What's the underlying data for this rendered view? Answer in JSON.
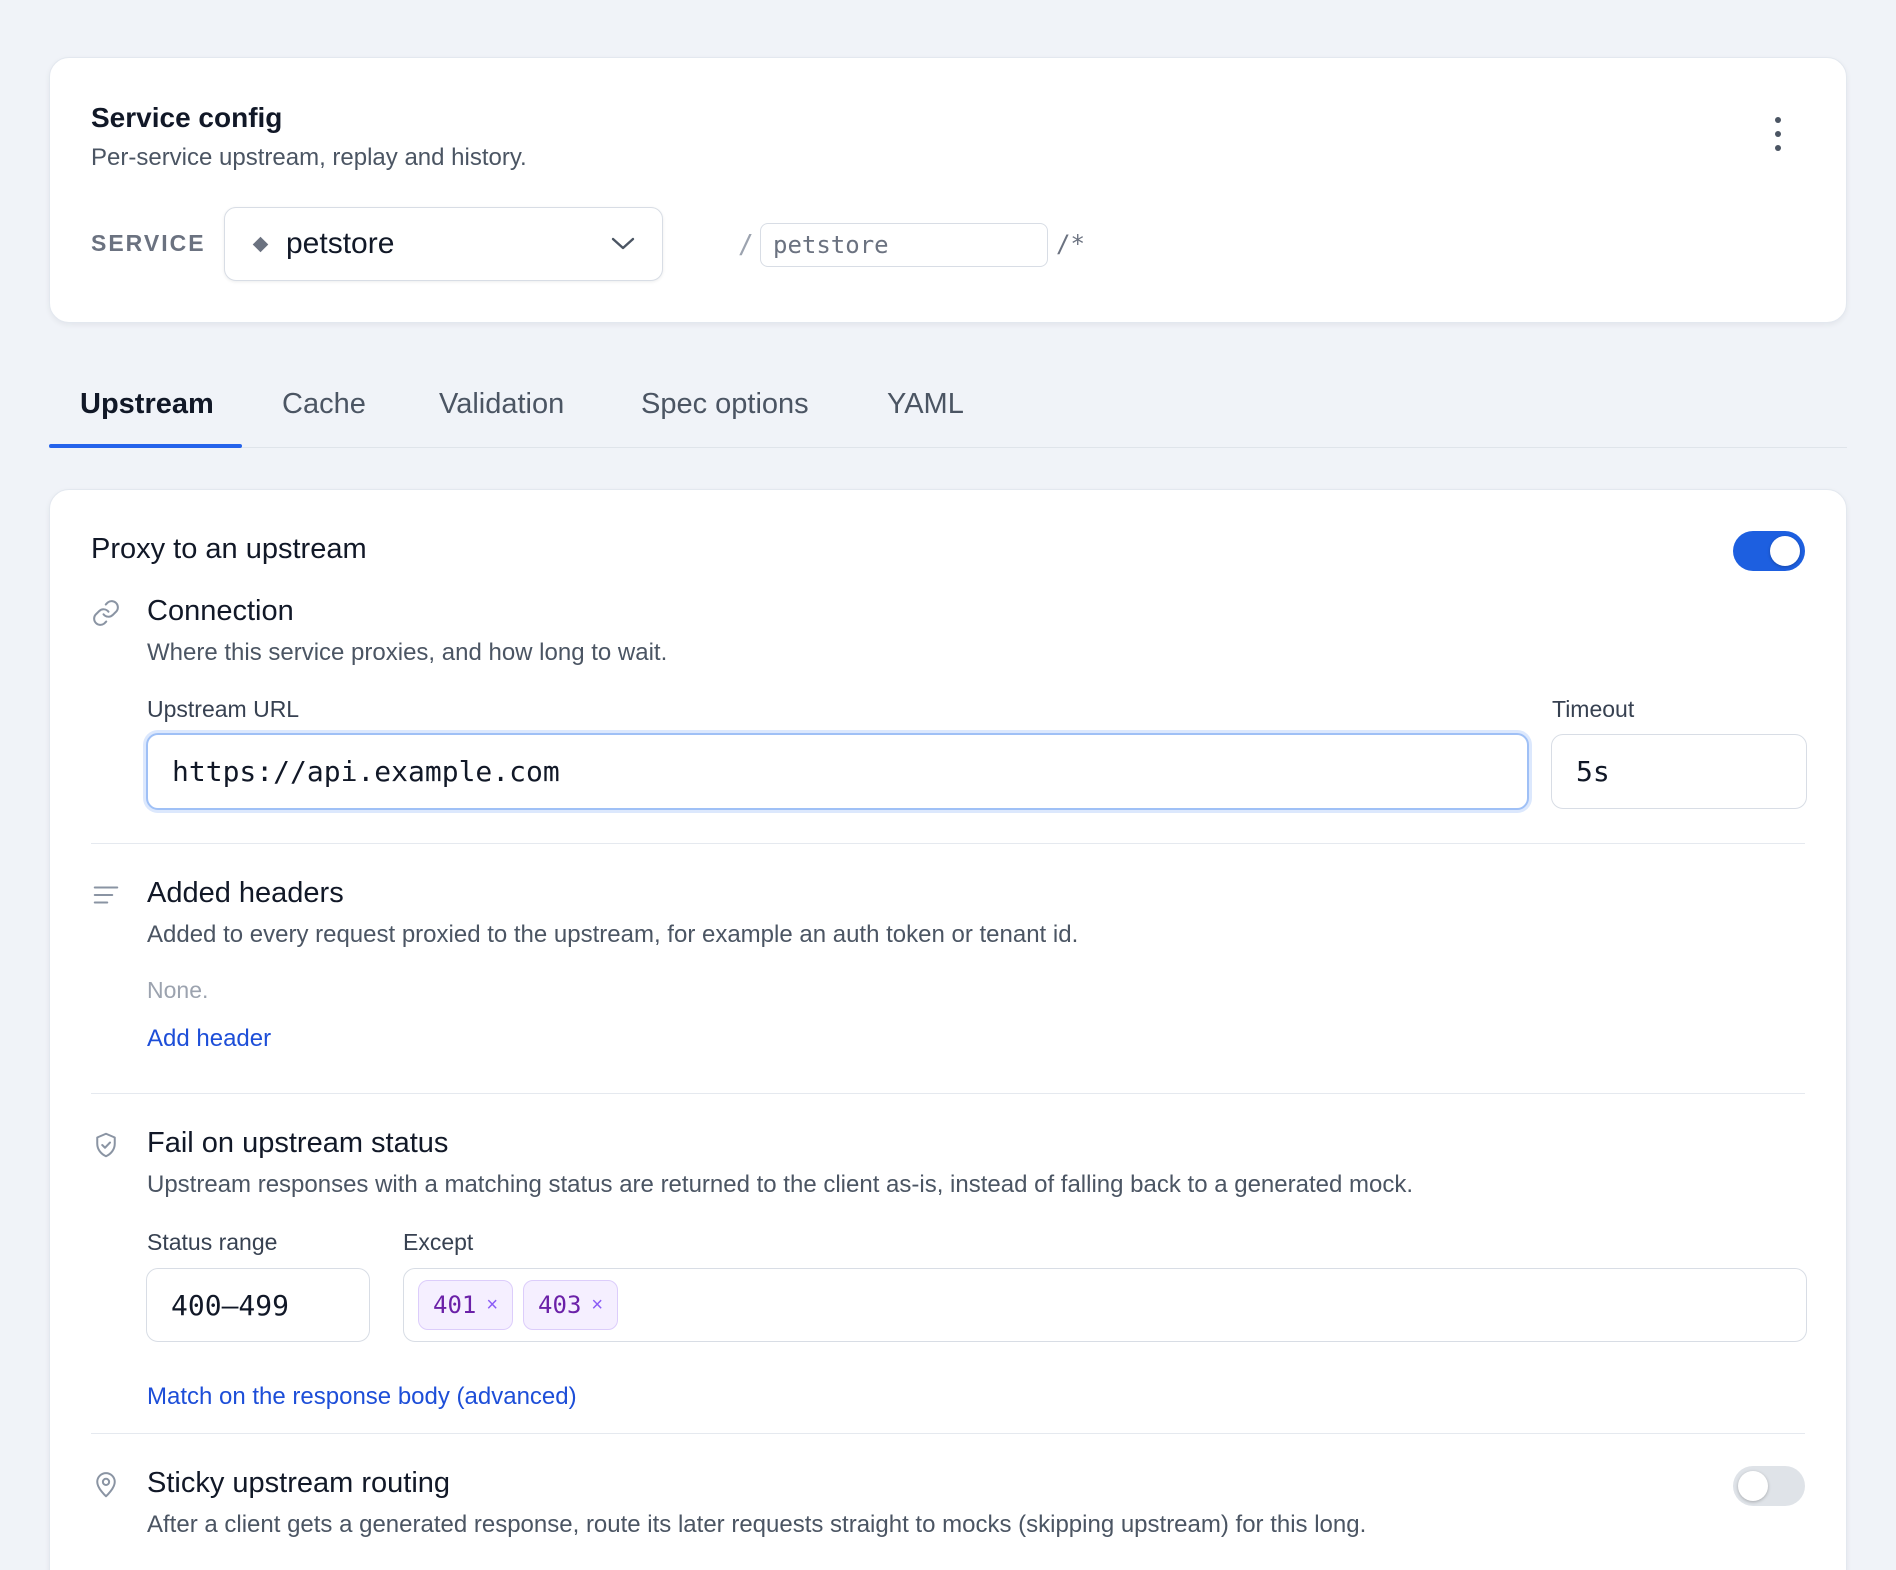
{
  "header": {
    "title": "Service config",
    "subtitle": "Per-service upstream, replay and history.",
    "service_label": "SERVICE",
    "service_value": "petstore",
    "path_prefix": "/",
    "path_value": "petstore",
    "path_suffix": "/*"
  },
  "tabs": [
    {
      "label": "Upstream",
      "active": true
    },
    {
      "label": "Cache",
      "active": false
    },
    {
      "label": "Validation",
      "active": false
    },
    {
      "label": "Spec options",
      "active": false
    },
    {
      "label": "YAML",
      "active": false
    }
  ],
  "upstream": {
    "proxy_title": "Proxy to an upstream",
    "proxy_enabled": true,
    "connection": {
      "title": "Connection",
      "description": "Where this service proxies, and how long to wait.",
      "url_label": "Upstream URL",
      "url_value": "https://api.example.com",
      "timeout_label": "Timeout",
      "timeout_value": "5s"
    },
    "headers": {
      "title": "Added headers",
      "description": "Added to every request proxied to the upstream, for example an auth token or tenant id.",
      "empty_text": "None.",
      "add_label": "Add header"
    },
    "fail_status": {
      "title": "Fail on upstream status",
      "description": "Upstream responses with a matching status are returned to the client as-is, instead of falling back to a generated mock.",
      "range_label": "Status range",
      "range_value": "400–499",
      "except_label": "Except",
      "except_values": [
        "401",
        "403"
      ],
      "remove_glyph": "×",
      "advanced_link": "Match on the response body (advanced)"
    },
    "sticky": {
      "title": "Sticky upstream routing",
      "description": "After a client gets a generated response, route its later requests straight to mocks (skipping upstream) for this long.",
      "enabled": false
    }
  },
  "colors": {
    "accent": "#2563eb",
    "toggle_on": "#1d5fe0",
    "link": "#1d4ed8",
    "chip_text": "#6b21a8",
    "chip_bg": "#f5efff"
  }
}
